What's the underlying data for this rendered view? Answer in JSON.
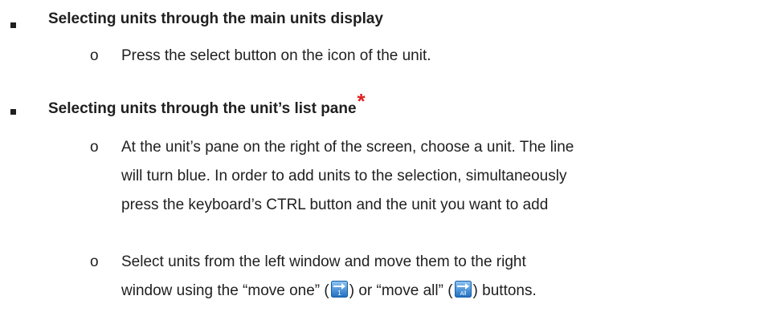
{
  "items": [
    {
      "heading": "Selecting units through the main units display",
      "sub": [
        {
          "lines": [
            "Press the select button on the icon of the unit."
          ]
        }
      ]
    },
    {
      "heading": "Selecting units through the unit’s list pane",
      "marker": "*",
      "sub": [
        {
          "lines": [
            "At the unit’s pane on the right of the screen, choose a unit. The line",
            "will turn blue. In order to add units to the selection, simultaneously",
            "press the keyboard’s CTRL button and the unit you want to add"
          ]
        },
        {
          "line1": "Select units from the left window and move them to the right",
          "line2_a": "window using the “move one” (",
          "line2_b": ") or “move all” (",
          "line2_c": ") buttons.",
          "icon_one_label": "1",
          "icon_all_label": "All"
        }
      ]
    }
  ],
  "sub_bullet_char": "o",
  "colors": {
    "text": "#1f1f1f",
    "asterisk": "#e02020",
    "icon_blue": "#2f7fd0"
  },
  "icons": {
    "move_one": "move-one-icon",
    "move_all": "move-all-icon"
  }
}
